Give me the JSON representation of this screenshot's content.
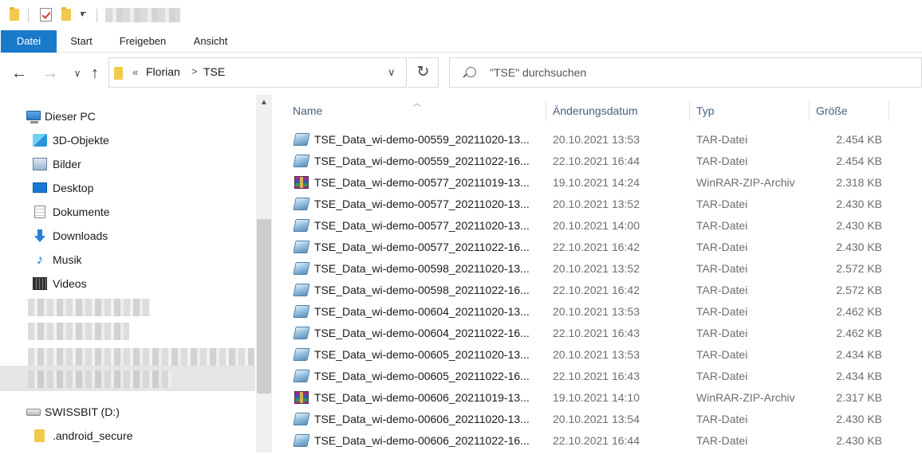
{
  "ribbon": {
    "tabs": [
      "Datei",
      "Start",
      "Freigeben",
      "Ansicht"
    ]
  },
  "address": {
    "chevrons": "«",
    "crumbs": [
      "Florian",
      "TSE"
    ],
    "separator": ">"
  },
  "search": {
    "placeholder": "\"TSE\" durchsuchen"
  },
  "navpane": {
    "this_pc": "Dieser PC",
    "items": [
      "3D-Objekte",
      "Bilder",
      "Desktop",
      "Dokumente",
      "Downloads",
      "Musik",
      "Videos"
    ],
    "drive": "SWISSBIT (D:)",
    "subfolder": ".android_secure"
  },
  "columns": {
    "name": "Name",
    "date": "Änderungsdatum",
    "type": "Typ",
    "size": "Größe"
  },
  "files": [
    {
      "name": "TSE_Data_wi-demo-00559_20211020-13...",
      "date": "20.10.2021 13:53",
      "type": "TAR-Datei",
      "size": "2.454 KB",
      "icon": "tar"
    },
    {
      "name": "TSE_Data_wi-demo-00559_20211022-16...",
      "date": "22.10.2021 16:44",
      "type": "TAR-Datei",
      "size": "2.454 KB",
      "icon": "tar"
    },
    {
      "name": "TSE_Data_wi-demo-00577_20211019-13...",
      "date": "19.10.2021 14:24",
      "type": "WinRAR-ZIP-Archiv",
      "size": "2.318 KB",
      "icon": "rar"
    },
    {
      "name": "TSE_Data_wi-demo-00577_20211020-13...",
      "date": "20.10.2021 13:52",
      "type": "TAR-Datei",
      "size": "2.430 KB",
      "icon": "tar"
    },
    {
      "name": "TSE_Data_wi-demo-00577_20211020-13...",
      "date": "20.10.2021 14:00",
      "type": "TAR-Datei",
      "size": "2.430 KB",
      "icon": "tar"
    },
    {
      "name": "TSE_Data_wi-demo-00577_20211022-16...",
      "date": "22.10.2021 16:42",
      "type": "TAR-Datei",
      "size": "2.430 KB",
      "icon": "tar"
    },
    {
      "name": "TSE_Data_wi-demo-00598_20211020-13...",
      "date": "20.10.2021 13:52",
      "type": "TAR-Datei",
      "size": "2.572 KB",
      "icon": "tar"
    },
    {
      "name": "TSE_Data_wi-demo-00598_20211022-16...",
      "date": "22.10.2021 16:42",
      "type": "TAR-Datei",
      "size": "2.572 KB",
      "icon": "tar"
    },
    {
      "name": "TSE_Data_wi-demo-00604_20211020-13...",
      "date": "20.10.2021 13:53",
      "type": "TAR-Datei",
      "size": "2.462 KB",
      "icon": "tar"
    },
    {
      "name": "TSE_Data_wi-demo-00604_20211022-16...",
      "date": "22.10.2021 16:43",
      "type": "TAR-Datei",
      "size": "2.462 KB",
      "icon": "tar"
    },
    {
      "name": "TSE_Data_wi-demo-00605_20211020-13...",
      "date": "20.10.2021 13:53",
      "type": "TAR-Datei",
      "size": "2.434 KB",
      "icon": "tar"
    },
    {
      "name": "TSE_Data_wi-demo-00605_20211022-16...",
      "date": "22.10.2021 16:43",
      "type": "TAR-Datei",
      "size": "2.434 KB",
      "icon": "tar"
    },
    {
      "name": "TSE_Data_wi-demo-00606_20211019-13...",
      "date": "19.10.2021 14:10",
      "type": "WinRAR-ZIP-Archiv",
      "size": "2.317 KB",
      "icon": "rar"
    },
    {
      "name": "TSE_Data_wi-demo-00606_20211020-13...",
      "date": "20.10.2021 13:54",
      "type": "TAR-Datei",
      "size": "2.430 KB",
      "icon": "tar"
    },
    {
      "name": "TSE_Data_wi-demo-00606_20211022-16...",
      "date": "22.10.2021 16:44",
      "type": "TAR-Datei",
      "size": "2.430 KB",
      "icon": "tar"
    }
  ],
  "colors": {
    "file_tab": "#1979ca",
    "header_text": "#4c607a",
    "folder": "#f2c94c"
  }
}
